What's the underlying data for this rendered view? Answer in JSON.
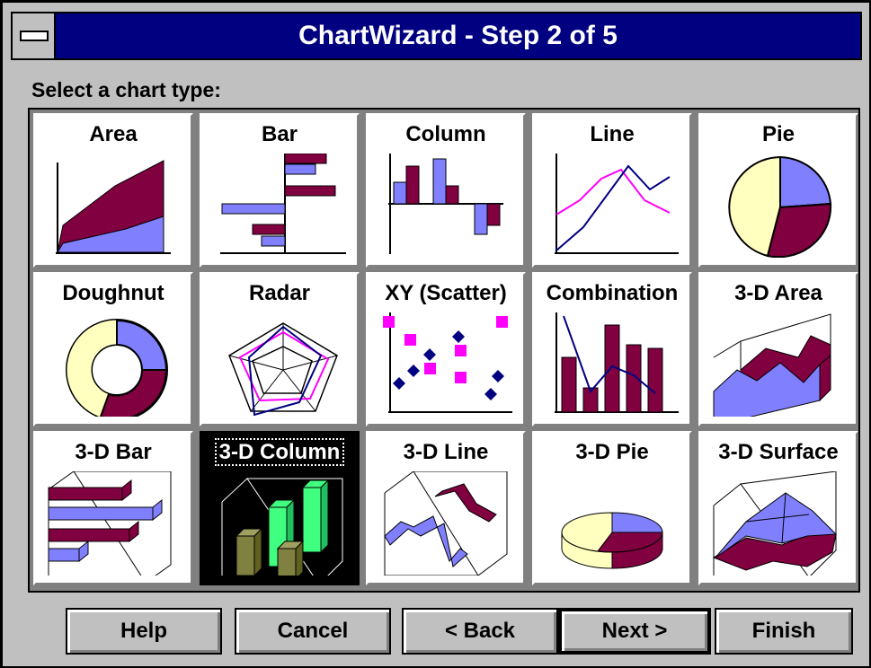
{
  "window": {
    "title": "ChartWizard - Step 2 of 5"
  },
  "prompt": "Select a chart type:",
  "chart_types": [
    {
      "id": "area",
      "label": "Area"
    },
    {
      "id": "bar",
      "label": "Bar"
    },
    {
      "id": "column",
      "label": "Column"
    },
    {
      "id": "line",
      "label": "Line"
    },
    {
      "id": "pie",
      "label": "Pie"
    },
    {
      "id": "doughnut",
      "label": "Doughnut"
    },
    {
      "id": "radar",
      "label": "Radar"
    },
    {
      "id": "xy-scatter",
      "label": "XY (Scatter)"
    },
    {
      "id": "combination",
      "label": "Combination"
    },
    {
      "id": "3d-area",
      "label": "3-D Area"
    },
    {
      "id": "3d-bar",
      "label": "3-D Bar"
    },
    {
      "id": "3d-column",
      "label": "3-D Column"
    },
    {
      "id": "3d-line",
      "label": "3-D Line"
    },
    {
      "id": "3d-pie",
      "label": "3-D Pie"
    },
    {
      "id": "3d-surface",
      "label": "3-D Surface"
    }
  ],
  "selected_chart_type": "3-D Column",
  "buttons": {
    "help": "Help",
    "cancel": "Cancel",
    "back": "< Back",
    "next": "Next >",
    "finish": "Finish"
  },
  "default_button": "Next >",
  "colors": {
    "titlebar": "#000080",
    "face": "#c0c0c0",
    "purple": "#800040",
    "blue": "#8080ff",
    "yellow": "#ffffc0",
    "magenta": "#ff00ff",
    "navy": "#000080",
    "green": "#40ff80",
    "olive": "#808040"
  }
}
